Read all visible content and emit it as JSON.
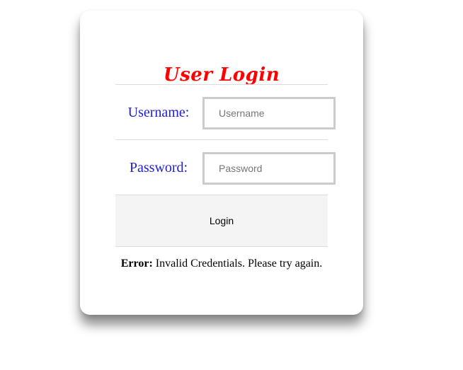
{
  "login_form": {
    "title": "User Login",
    "username": {
      "label": "Username:",
      "placeholder": "Username",
      "value": ""
    },
    "password": {
      "label": "Password:",
      "placeholder": "Password",
      "value": ""
    },
    "submit_label": "Login",
    "error": {
      "prefix": "Error:",
      "message": " Invalid Credentials. Please try again."
    }
  },
  "colors": {
    "title": "#ff0000",
    "labels": "#1f1fd6",
    "login_row_background": "#f4f4f4",
    "field_border": "#cccccc"
  }
}
